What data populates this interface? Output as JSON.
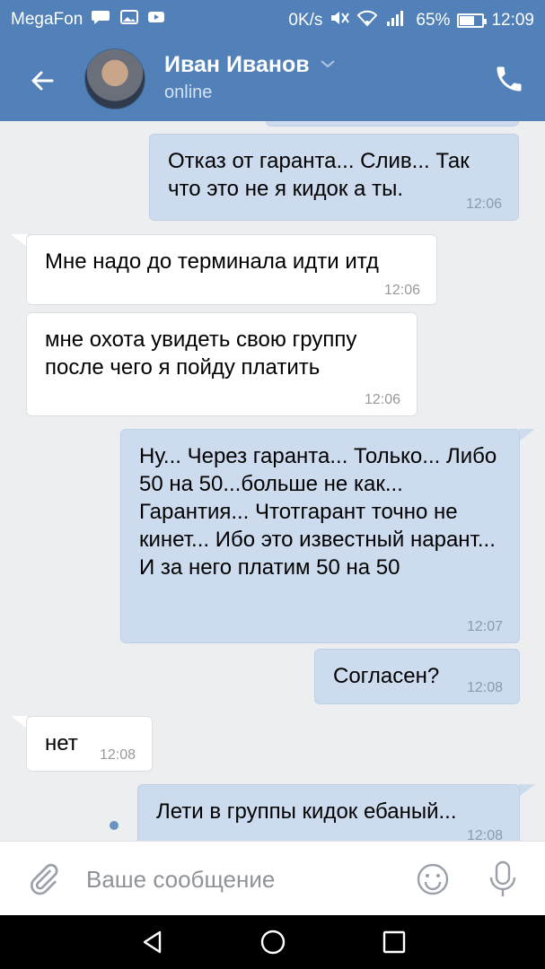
{
  "status_bar": {
    "carrier": "MegaFon",
    "speed": "0K/s",
    "signal": "4G",
    "battery": "65%",
    "battery_level": 0.65,
    "time": "12:09"
  },
  "header": {
    "contact_name": "Иван Иванов",
    "status": "online"
  },
  "messages": [
    {
      "direction": "out",
      "text": "Отказ от гаранта... Слив... Так что это не я кидок а ты.",
      "time": "12:06"
    },
    {
      "direction": "in",
      "text": "Мне надо до терминала идти итд",
      "time": "12:06"
    },
    {
      "direction": "in",
      "text": "мне охота увидеть свою группу после чего я пойду платить",
      "time": "12:06"
    },
    {
      "direction": "out",
      "text": "Ну... Через гаранта... Только... Либо 50 на 50...больше не как... Гарантия... Чтотгарант точно не кинет... Ибо это известный нарант... И за него платим 50 на 50",
      "time": "12:07"
    },
    {
      "direction": "out",
      "text": "Согласен?",
      "time": "12:08"
    },
    {
      "direction": "in",
      "text": "нет",
      "time": "12:08"
    },
    {
      "direction": "out",
      "text": "Лети в группы кидок ебаный...",
      "time": "12:08",
      "unread": true
    }
  ],
  "composer": {
    "placeholder": "Ваше сообщение"
  },
  "icons": {
    "back": "arrow-left-icon",
    "call": "phone-icon",
    "attach": "paperclip-icon",
    "emoji": "smiley-icon",
    "mic": "microphone-icon",
    "nav_back": "triangle-back-icon",
    "nav_home": "circle-home-icon",
    "nav_recent": "square-recent-icon"
  },
  "colors": {
    "header": "#5181b8",
    "outgoing_bubble": "#ccdcee",
    "incoming_bubble": "#ffffff",
    "background": "#edeef0"
  }
}
